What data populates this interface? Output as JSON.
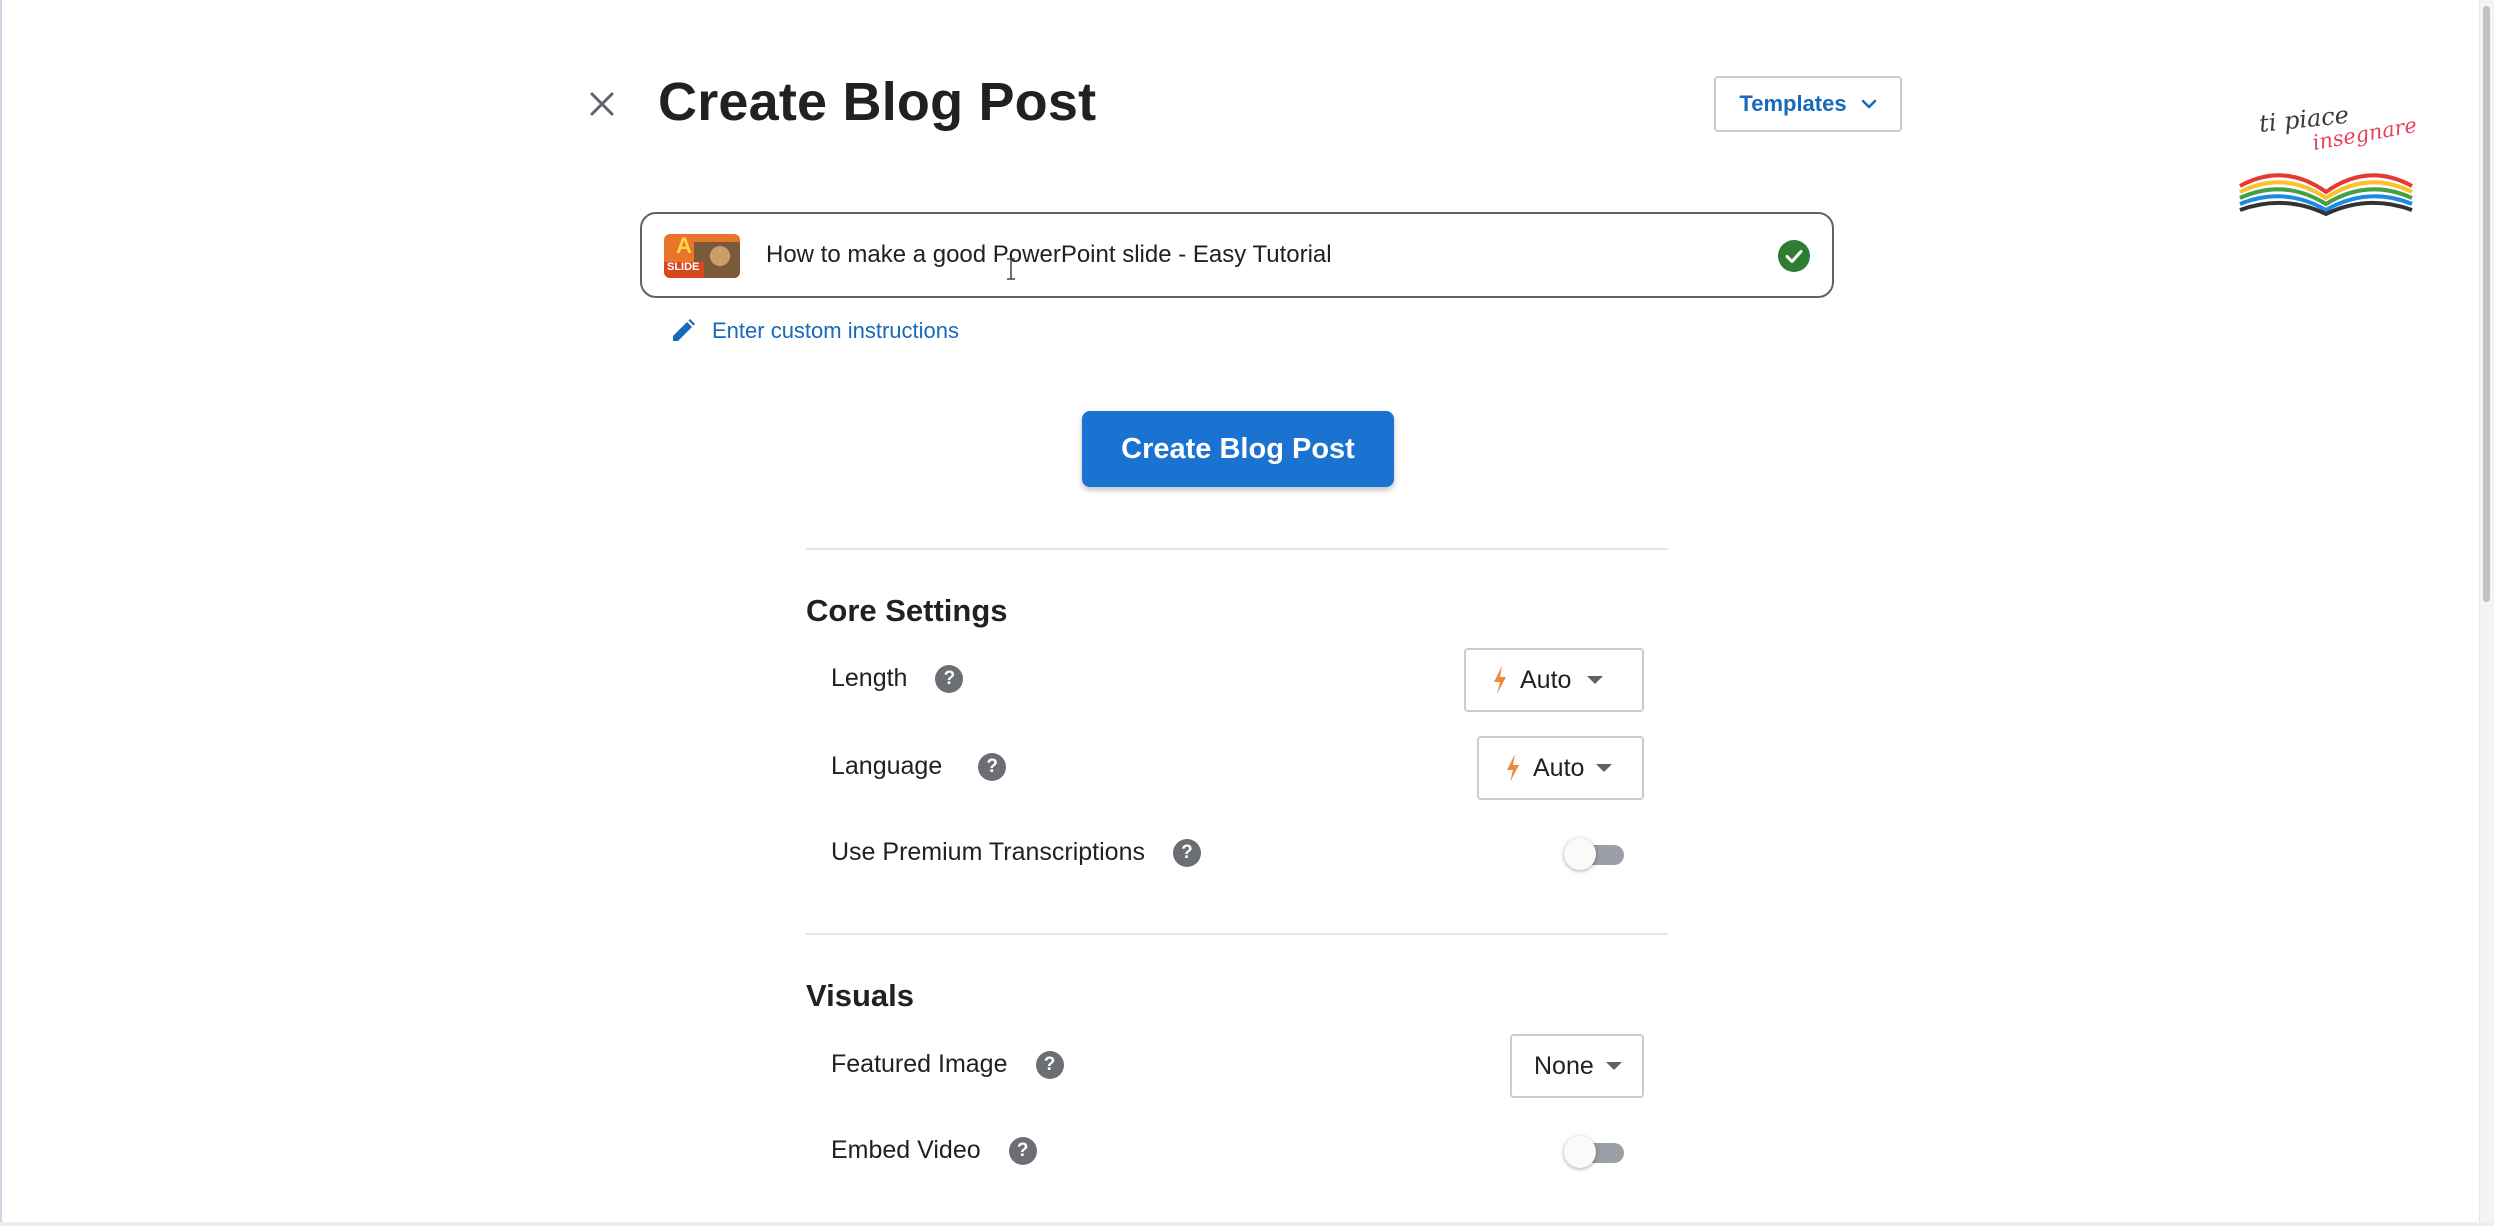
{
  "header": {
    "title": "Create Blog Post",
    "templates_label": "Templates"
  },
  "logo": {
    "line1": "ti piace",
    "line2": "insegnare"
  },
  "video": {
    "thumbnail_text_top": "A",
    "thumbnail_text_bottom": "SLIDE",
    "title": "How to make a good PowerPoint slide - Easy Tutorial",
    "status": "verified"
  },
  "custom_instructions": {
    "label": "Enter custom instructions"
  },
  "primary_action": {
    "label": "Create Blog Post"
  },
  "core_settings": {
    "title": "Core Settings",
    "length": {
      "label": "Length",
      "value": "Auto"
    },
    "language": {
      "label": "Language",
      "value": "Auto"
    },
    "premium": {
      "label": "Use Premium Transcriptions",
      "enabled": false
    }
  },
  "visuals": {
    "title": "Visuals",
    "featured_image": {
      "label": "Featured Image",
      "value": "None"
    },
    "embed_video": {
      "label": "Embed Video",
      "enabled": false
    }
  },
  "colors": {
    "primary": "#1a73d0",
    "link": "#1669bb",
    "success": "#2e7d32",
    "bolt": "#f0883e"
  },
  "icons": [
    "close-icon",
    "chevron-down-icon",
    "check-circle-icon",
    "pencil-icon",
    "help-icon",
    "bolt-icon",
    "caret-down-icon"
  ]
}
